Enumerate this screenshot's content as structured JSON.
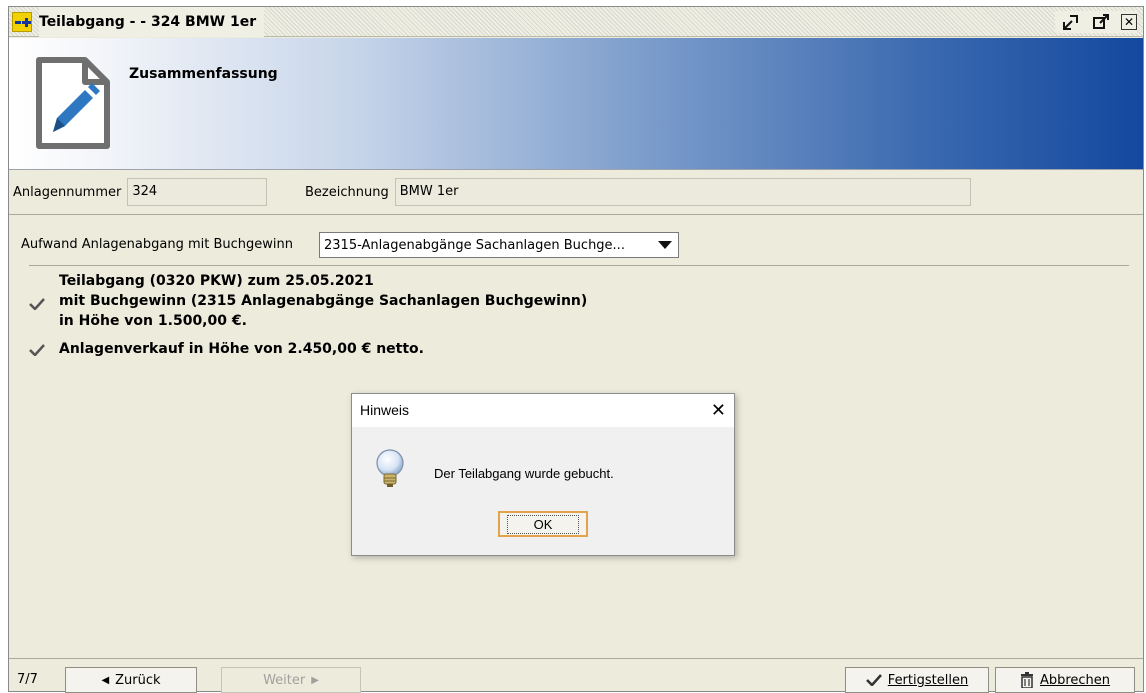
{
  "window": {
    "title": "Teilabgang -  - 324 BMW 1er"
  },
  "banner": {
    "title": "Zusammenfassung"
  },
  "fields": {
    "anlagennummer_label": "Anlagennummer",
    "anlagennummer_value": "324",
    "bezeichnung_label": "Bezeichnung",
    "bezeichnung_value": "BMW 1er"
  },
  "aufwand": {
    "label": "Aufwand Anlagenabgang mit Buchgewinn",
    "selected": "2315-Anlagenabgänge Sachanlagen Buchge..."
  },
  "summary": {
    "item1_line1": "Teilabgang (0320 PKW) zum 25.05.2021",
    "item1_line2": "mit Buchgewinn (2315 Anlagenabgänge Sachanlagen Buchgewinn)",
    "item1_line3": "in Höhe von 1.500,00 €.",
    "item2": "Anlagenverkauf in Höhe von 2.450,00 € netto."
  },
  "dialog": {
    "title": "Hinweis",
    "message": "Der Teilabgang wurde gebucht.",
    "ok_label": "OK"
  },
  "footer": {
    "page_indicator": "7/7",
    "back_label": "Zurück",
    "next_label": "Weiter",
    "finish_label": "Fertigstellen",
    "cancel_label": "Abbrechen"
  }
}
